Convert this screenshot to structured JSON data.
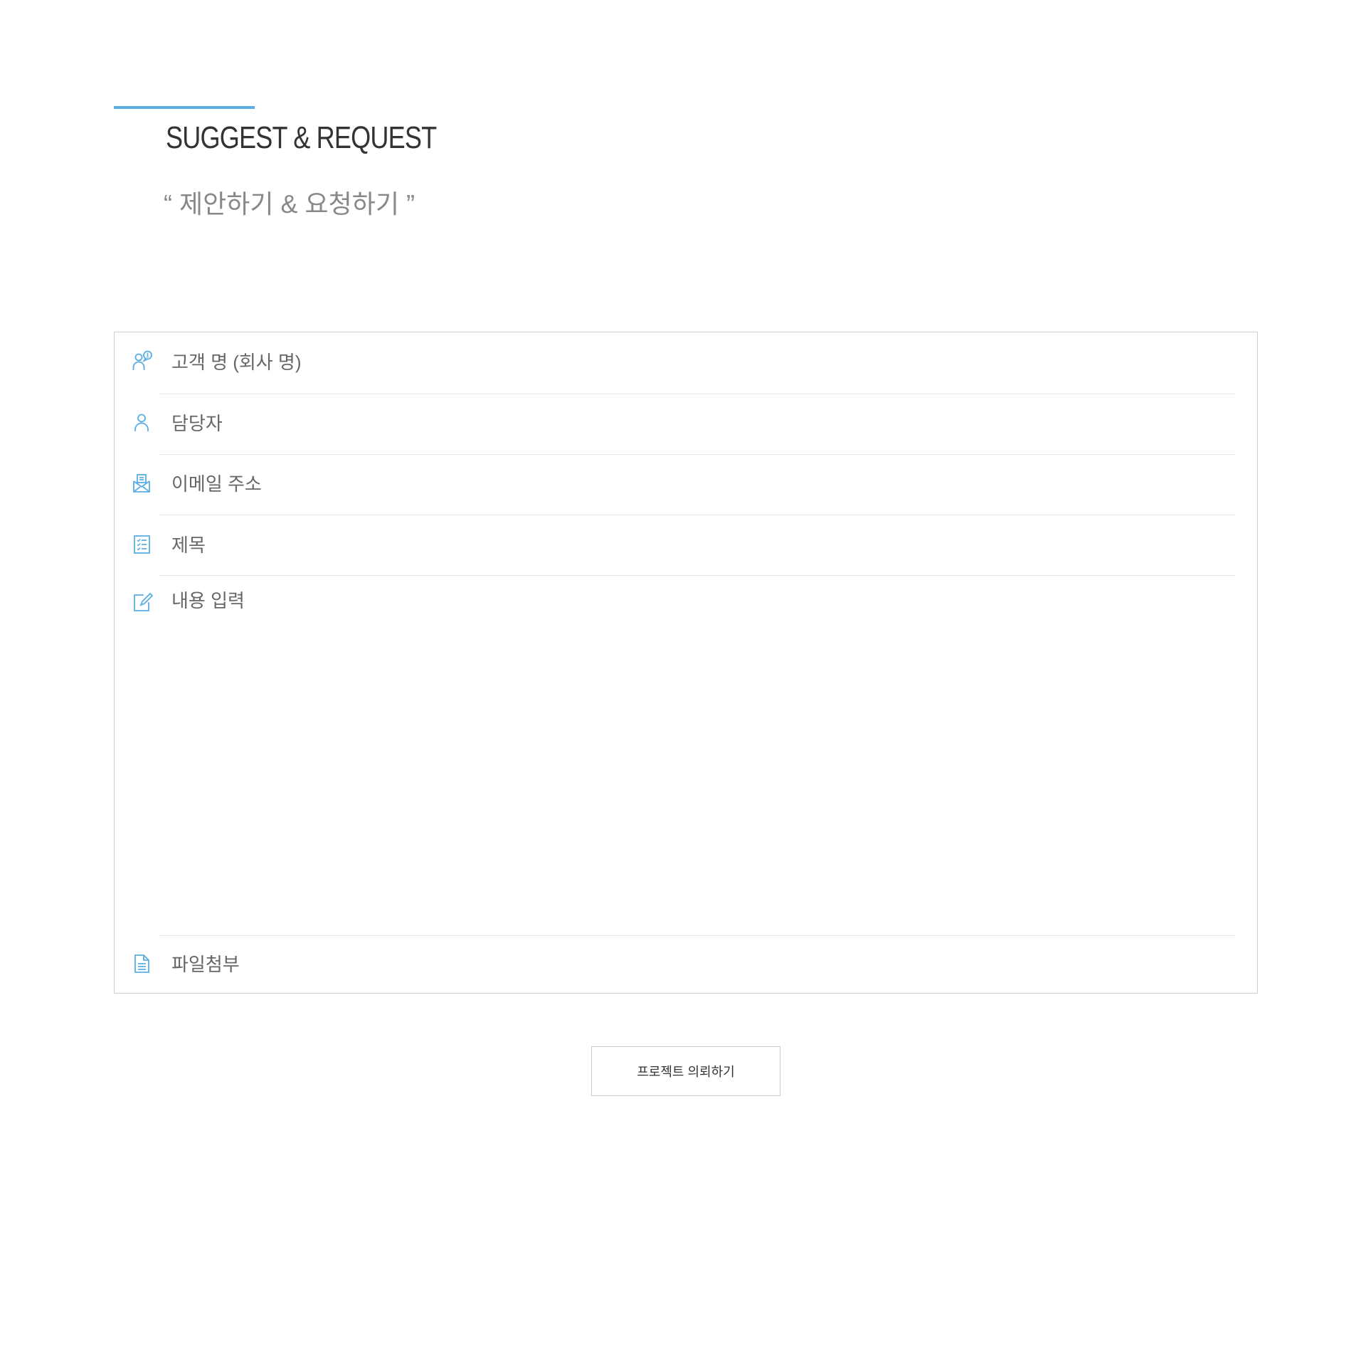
{
  "header": {
    "title": "SUGGEST & REQUEST",
    "subtitle": "“ 제안하기 & 요청하기 ”",
    "accent_color": "#5aaee3"
  },
  "form": {
    "fields": [
      {
        "icon": "customer-chat-icon",
        "placeholder": "고객 명 (회사 명)",
        "value": ""
      },
      {
        "icon": "person-icon",
        "placeholder": "담당자",
        "value": ""
      },
      {
        "icon": "envelope-icon",
        "placeholder": "이메일 주소",
        "value": ""
      },
      {
        "icon": "checklist-icon",
        "placeholder": "제목",
        "value": ""
      },
      {
        "icon": "edit-icon",
        "placeholder": "내용 입력",
        "value": ""
      },
      {
        "icon": "document-icon",
        "placeholder": "파일첨부",
        "value": ""
      }
    ],
    "icon_color": "#5aaee3"
  },
  "submit": {
    "label": "프로젝트 의뢰하기"
  }
}
